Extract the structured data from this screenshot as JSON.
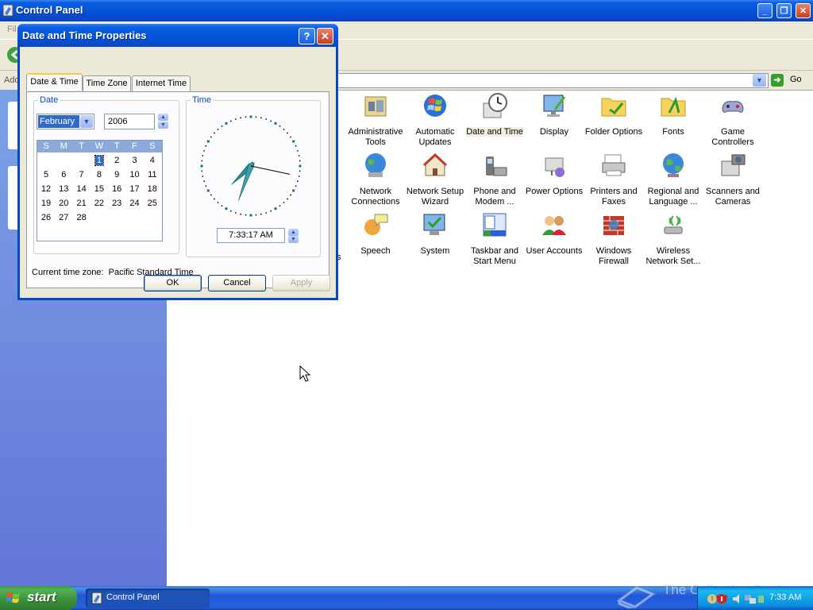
{
  "window": {
    "title": "Control Panel"
  },
  "menubar": {
    "first_item": "Fil"
  },
  "addressbar": {
    "label": "Add",
    "go_label": "Go"
  },
  "control_panel_items": [
    {
      "label": "Administrative Tools",
      "icon": "administrative-tools-icon"
    },
    {
      "label": "Automatic Updates",
      "icon": "automatic-updates-icon"
    },
    {
      "label": "Date and Time",
      "icon": "date-and-time-icon",
      "selected": true
    },
    {
      "label": "Display",
      "icon": "display-icon"
    },
    {
      "label": "Folder Options",
      "icon": "folder-options-icon"
    },
    {
      "label": "Fonts",
      "icon": "fonts-folder-icon"
    },
    {
      "label": "Game Controllers",
      "icon": "game-controllers-icon"
    },
    {
      "label": "Network Connections",
      "icon": "network-connections-icon"
    },
    {
      "label": "Network Setup Wizard",
      "icon": "network-setup-wizard-icon"
    },
    {
      "label": "Phone and Modem ...",
      "icon": "phone-and-modem-icon"
    },
    {
      "label": "Power Options",
      "icon": "power-options-icon"
    },
    {
      "label": "Printers and Faxes",
      "icon": "printers-and-faxes-icon"
    },
    {
      "label": "Regional and Language ...",
      "icon": "regional-language-icon"
    },
    {
      "label": "Scanners and Cameras",
      "icon": "scanners-cameras-icon"
    },
    {
      "label": "Speech",
      "icon": "speech-icon"
    },
    {
      "label": "System",
      "icon": "system-icon"
    },
    {
      "label": "Taskbar and Start Menu",
      "icon": "taskbar-start-menu-icon"
    },
    {
      "label": "User Accounts",
      "icon": "user-accounts-icon"
    },
    {
      "label": "Windows Firewall",
      "icon": "windows-firewall-icon"
    },
    {
      "label": "Wireless Network Set...",
      "icon": "wireless-network-icon"
    }
  ],
  "partial_label": "s",
  "dialog": {
    "title": "Date and Time Properties",
    "help": "?",
    "close": "✕",
    "tabs": [
      "Date & Time",
      "Time Zone",
      "Internet Time"
    ],
    "date_group_label": "Date",
    "time_group_label": "Time",
    "month": "February",
    "year": "2006",
    "weekdays": [
      "S",
      "M",
      "T",
      "W",
      "T",
      "F",
      "S"
    ],
    "weeks": [
      [
        "",
        "",
        "",
        "1",
        "2",
        "3",
        "4"
      ],
      [
        "5",
        "6",
        "7",
        "8",
        "9",
        "10",
        "11"
      ],
      [
        "12",
        "13",
        "14",
        "15",
        "16",
        "17",
        "18"
      ],
      [
        "19",
        "20",
        "21",
        "22",
        "23",
        "24",
        "25"
      ],
      [
        "26",
        "27",
        "28",
        "",
        "",
        "",
        ""
      ]
    ],
    "selected_day": "1",
    "time": "7:33:17 AM",
    "clock_time": {
      "hour": 7,
      "minute": 33,
      "second": 17
    },
    "timezone_label": "Current time zone:",
    "timezone": "Pacific Standard Time",
    "buttons": {
      "ok": "OK",
      "cancel": "Cancel",
      "apply": "Apply"
    }
  },
  "taskbar": {
    "start_label": "start",
    "task_label": "Control Panel",
    "clock": "7:33 AM"
  },
  "watermark": "The Collection Book",
  "colors": {
    "xp_blue": "#0551d8",
    "start_green": "#3b8f3b",
    "dialog_face": "#ece9d8",
    "selection": "#316ac5"
  }
}
